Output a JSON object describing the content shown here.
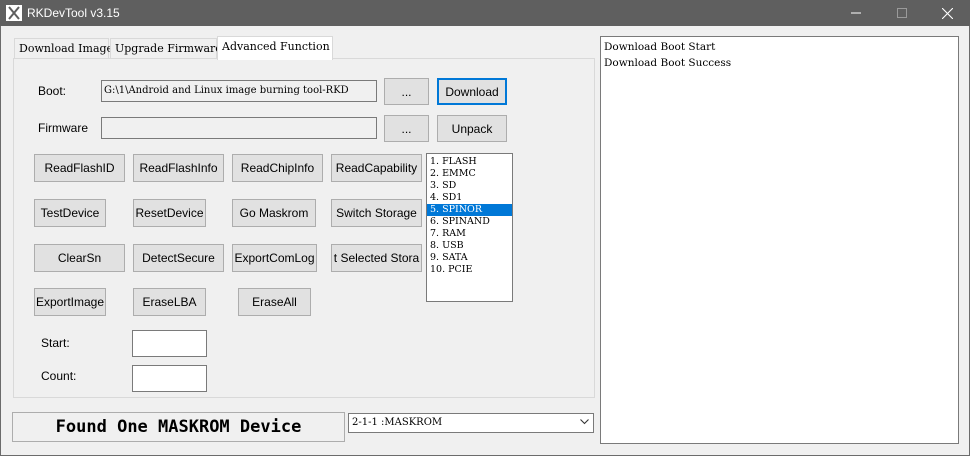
{
  "window": {
    "title": "RKDevTool v3.15"
  },
  "tabs": [
    {
      "label": "Download Image"
    },
    {
      "label": "Upgrade Firmware"
    },
    {
      "label": "Advanced Function"
    }
  ],
  "boot": {
    "label": "Boot:",
    "value": "G:\\1\\Android and Linux image burning tool-RKD",
    "browse_label": "...",
    "action_label": "Download"
  },
  "firmware": {
    "label": "Firmware",
    "value": "",
    "browse_label": "...",
    "action_label": "Unpack"
  },
  "buttons": {
    "read_flash_id": "ReadFlashID",
    "read_flash_info": "ReadFlashInfo",
    "read_chip_info": "ReadChipInfo",
    "read_capability": "ReadCapability",
    "test_device": "TestDevice",
    "reset_device": "ResetDevice",
    "go_maskrom": "Go Maskrom",
    "switch_storage": "Switch Storage",
    "clear_sn": "ClearSn",
    "detect_secure": "DetectSecure",
    "export_com_log": "ExportComLog",
    "selected_storage": "t Selected Stora",
    "export_image": "ExportImage",
    "erase_lba": "EraseLBA",
    "erase_all": "EraseAll"
  },
  "storage_list": {
    "items": [
      "1.  FLASH",
      "2.  EMMC",
      "3.  SD",
      "4.  SD1",
      "5.  SPINOR",
      "6.  SPINAND",
      "7.  RAM",
      "8.  USB",
      "9.  SATA",
      "10.  PCIE"
    ],
    "selected": "5.  SPINOR"
  },
  "range": {
    "start_label": "Start:",
    "start_value": "",
    "count_label": "Count:",
    "count_value": ""
  },
  "status": {
    "text": "Found One MASKROM Device"
  },
  "device_select": {
    "value": "2-1-1  :MASKROM"
  },
  "log": {
    "lines": [
      "Download Boot Start",
      "Download Boot Success"
    ]
  }
}
